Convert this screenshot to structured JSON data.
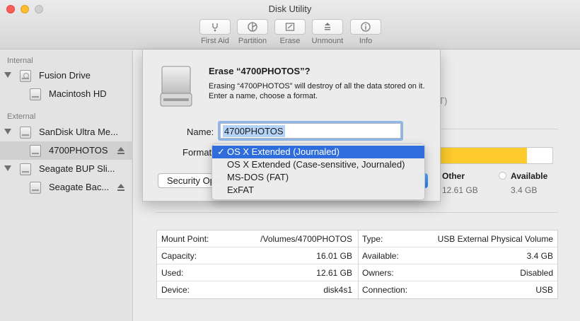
{
  "window": {
    "title": "Disk Utility"
  },
  "toolbar": [
    {
      "label": "First Aid",
      "icon": "first-aid-icon"
    },
    {
      "label": "Partition",
      "icon": "partition-icon"
    },
    {
      "label": "Erase",
      "icon": "erase-icon"
    },
    {
      "label": "Unmount",
      "icon": "unmount-icon"
    },
    {
      "label": "Info",
      "icon": "info-icon"
    }
  ],
  "sidebar": {
    "internal_heading": "Internal",
    "external_heading": "External",
    "items": [
      {
        "label": "Fusion Drive"
      },
      {
        "label": "Macintosh HD"
      },
      {
        "label": "SanDisk Ultra Me..."
      },
      {
        "label": "4700PHOTOS"
      },
      {
        "label": "Seagate BUP Sli..."
      },
      {
        "label": "Seagate Bac..."
      }
    ]
  },
  "dialog": {
    "title": "Erase “4700PHOTOS”?",
    "message": "Erasing “4700PHOTOS” will destroy of all the data stored on it. Enter a name, choose a format.",
    "name_label": "Name:",
    "name_value": "4700PHOTOS",
    "format_label": "Format",
    "security_button": "Security Options...",
    "format_options": [
      {
        "label": "OS X Extended (Journaled)",
        "selected": true
      },
      {
        "label": "OS X Extended (Case-sensitive, Journaled)",
        "selected": false
      },
      {
        "label": "MS-DOS (FAT)",
        "selected": false
      },
      {
        "label": "ExFAT",
        "selected": false
      }
    ]
  },
  "usage": {
    "used_fraction": 0.788,
    "fill_color": "#fdcb2d",
    "partial_text": "T)",
    "other_label": "Other",
    "other_value": "12.61 GB",
    "available_label": "Available",
    "available_value": "3.4 GB"
  },
  "info": {
    "left": [
      {
        "key": "Mount Point:",
        "value": "/Volumes/4700PHOTOS"
      },
      {
        "key": "Capacity:",
        "value": "16.01 GB"
      },
      {
        "key": "Used:",
        "value": "12.61 GB"
      },
      {
        "key": "Device:",
        "value": "disk4s1"
      }
    ],
    "right": [
      {
        "key": "Type:",
        "value": "USB External Physical Volume"
      },
      {
        "key": "Available:",
        "value": "3.4 GB"
      },
      {
        "key": "Owners:",
        "value": "Disabled"
      },
      {
        "key": "Connection:",
        "value": "USB"
      }
    ]
  },
  "colors": {
    "accent": "#2f6ddc",
    "selection": "#b4d3f6"
  }
}
